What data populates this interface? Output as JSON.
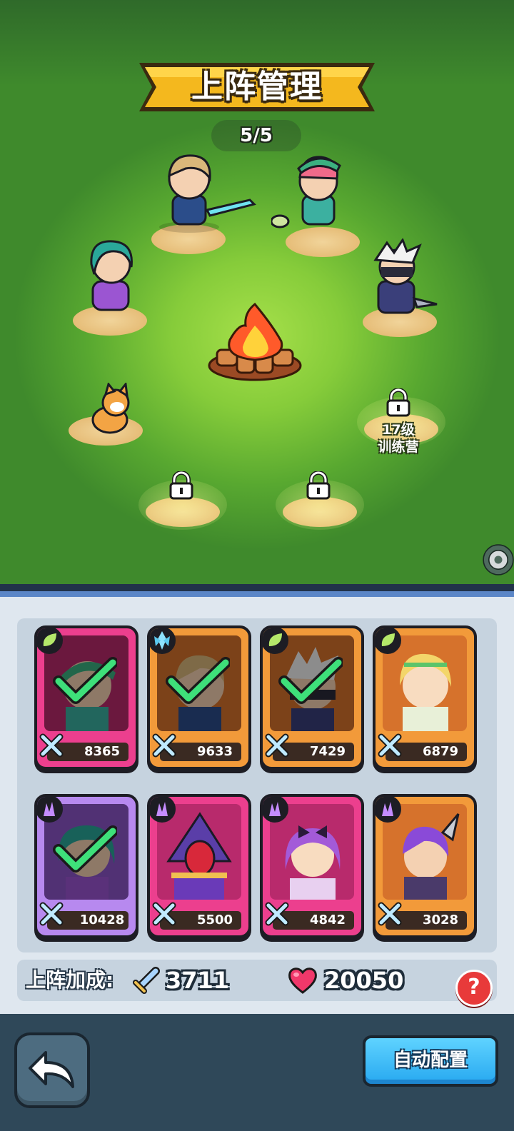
{
  "header": {
    "title": "上阵管理",
    "deploy_count": "5/5"
  },
  "battlefield": {
    "locked_slot_label_line1": "17级",
    "locked_slot_label_line2": "训练营",
    "heroes_placed": [
      "swordsman",
      "green-hat-archer",
      "dancer",
      "ninja",
      "shiba-dog"
    ]
  },
  "roster": {
    "cards": [
      {
        "power": "8365",
        "rarity": "pink",
        "element": "leaf",
        "deployed": true,
        "hero": "green-hat-archer"
      },
      {
        "power": "9633",
        "rarity": "orange",
        "element": "ice",
        "deployed": true,
        "hero": "swordsman"
      },
      {
        "power": "7429",
        "rarity": "orange",
        "element": "leaf",
        "deployed": true,
        "hero": "ninja"
      },
      {
        "power": "6879",
        "rarity": "orange",
        "element": "leaf",
        "deployed": false,
        "hero": "elf-archer"
      },
      {
        "power": "10428",
        "rarity": "purple",
        "element": "dark",
        "deployed": true,
        "hero": "dancer"
      },
      {
        "power": "5500",
        "rarity": "pink",
        "element": "dark",
        "deployed": false,
        "hero": "masked-wizard"
      },
      {
        "power": "4842",
        "rarity": "pink",
        "element": "dark",
        "deployed": false,
        "hero": "purple-girl"
      },
      {
        "power": "3028",
        "rarity": "orange",
        "element": "dark",
        "deployed": false,
        "hero": "horned-warrior"
      }
    ]
  },
  "bonus": {
    "label": "上阵加成:",
    "attack": "3711",
    "hp": "20050"
  },
  "actions": {
    "help": "?",
    "auto": "自动配置"
  },
  "colors": {
    "pink_card": "#ec3f8e",
    "orange_card": "#f29a3a",
    "purple_card": "#b789ef",
    "auto_button": "#27a8f0"
  }
}
